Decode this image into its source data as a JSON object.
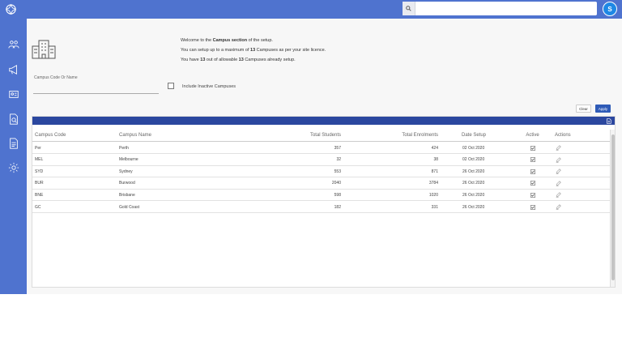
{
  "header": {
    "search_placeholder": "",
    "avatar_initial": "S"
  },
  "sidebar": {
    "icons": [
      "users-icon",
      "megaphone-icon",
      "id-card-icon",
      "search-document-icon",
      "report-icon",
      "gear-icon"
    ]
  },
  "welcome": {
    "line1": {
      "pre": "Welcome to the ",
      "bold": "Campus section",
      "post": " of the setup."
    },
    "line2": {
      "pre": "You can setup up to a maximum of ",
      "bold": "13",
      "post": " Campuses as per your site licence."
    },
    "line3": {
      "pre": "You have ",
      "bold1": "13",
      "mid": " out of allowable ",
      "bold2": "13",
      "post": " Campuses already setup."
    }
  },
  "filters": {
    "campus_label": "Campus Code Or Name",
    "campus_value": "",
    "inactive_label": "Include Inactive Campuses"
  },
  "buttons": {
    "clear": "Clear",
    "apply": "Apply"
  },
  "grid": {
    "columns": [
      "Campus Code",
      "Campus Name",
      "Total Students",
      "Total Enrolments",
      "Date Setup",
      "Active",
      "Actions"
    ],
    "rows": [
      {
        "code": "Per",
        "name": "Perth",
        "students": "357",
        "enrolments": "424",
        "date": "02 Oct 2020"
      },
      {
        "code": "MEL",
        "name": "Melbourne",
        "students": "32",
        "enrolments": "38",
        "date": "02 Oct 2020"
      },
      {
        "code": "SYD",
        "name": "Sydney",
        "students": "553",
        "enrolments": "871",
        "date": "26 Oct 2020"
      },
      {
        "code": "BUR",
        "name": "Burwood",
        "students": "2040",
        "enrolments": "3784",
        "date": "26 Oct 2020"
      },
      {
        "code": "BNE",
        "name": "Brisbane",
        "students": "598",
        "enrolments": "1020",
        "date": "26 Oct 2020"
      },
      {
        "code": "GC",
        "name": "Gold Coast",
        "students": "182",
        "enrolments": "331",
        "date": "26 Oct 2020"
      }
    ]
  },
  "colors": {
    "brand": "#4f73cf",
    "grid_toolbar": "#2b479f",
    "apply": "#2f5bb7",
    "avatar": "#1e88e5"
  }
}
